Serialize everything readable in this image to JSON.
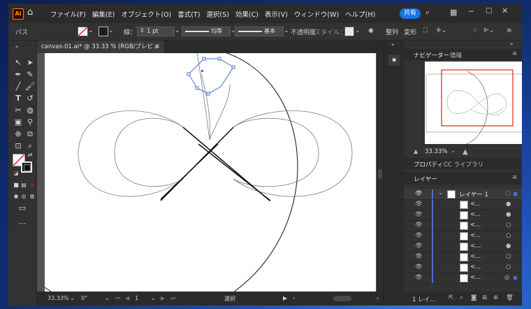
{
  "app": {
    "logo": "Ai"
  },
  "menu": [
    "ファイル(F)",
    "編集(E)",
    "オブジェクト(O)",
    "書式(T)",
    "選択(S)",
    "効果(C)",
    "表示(V)",
    "ウィンドウ(W)",
    "ヘルプ(H)"
  ],
  "titlebar": {
    "share_label": "共有"
  },
  "control": {
    "selection_label": "パス",
    "stroke_label": "線：",
    "stroke_weight": "1 pt",
    "profile1": "均等",
    "profile2": "基本",
    "opacity_label": "不透明度",
    "style_label": "スタイル：",
    "align_label": "整列",
    "transform_label": "変形"
  },
  "document": {
    "tab_title": "canvas-01.ai* @ 33.33 % (RGB/プレビュー)"
  },
  "status": {
    "zoom": "33.33%",
    "rotation": "0°",
    "artboard": "1",
    "tool": "選択"
  },
  "panels": {
    "navigator_tab": "ナビゲーター",
    "info_tab": "情報",
    "nav_zoom": "33.33%",
    "properties_tab": "プロパティ",
    "libraries_tab": "CC ライブラリ",
    "layers_tab": "レイヤー",
    "layer_name": "レイヤー 1",
    "sublayers": [
      "<...",
      "<...",
      "<...",
      "<...",
      "<...",
      "<...",
      "<...",
      "<..."
    ],
    "layer_count": "1 レイ..."
  },
  "colors": {
    "accent": "#1473e6",
    "selection": "#4a6fd6",
    "navigator_frame": "#e02020"
  }
}
